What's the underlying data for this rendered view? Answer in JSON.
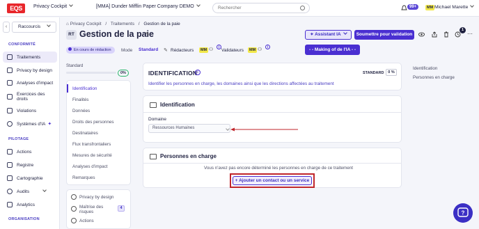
{
  "topbar": {
    "logo": "EQS",
    "app": "Privacy Cockpit",
    "company": "[MMA] Dunder Mifflin Paper Company DEMO",
    "search_placeholder": "Rechercher",
    "notif_count": "99+",
    "user_initials": "MM",
    "user_name": "Michael Marette"
  },
  "sidebar": {
    "shortcut_label": "Raccourcis",
    "section_conformite": "CONFORMITÉ",
    "items_conformite": [
      "Traitements",
      "Privacy by design",
      "Analyses d'impact",
      "Exercices des droits",
      "Violations",
      "Systèmes d'IA"
    ],
    "section_pilotage": "PILOTAGE",
    "items_pilotage": [
      "Actions",
      "Registre",
      "Cartographie",
      "Audits",
      "Analytics"
    ],
    "section_organisation": "ORGANISATION"
  },
  "breadcrumb": [
    "Privacy Cockpit",
    "Traitements",
    "Gestion de la paie"
  ],
  "header": {
    "tag": "RT",
    "title": "Gestion de la paie",
    "status": "En cours de rédaction",
    "mode_label": "Mode",
    "mode_value": "Standard",
    "redacteurs_label": "Rédacteurs",
    "validateurs_label": "Validateurs",
    "avatar": "MM",
    "assistant_button": "Assistant IA",
    "submit_button": "Soumettre pour validation",
    "making_of_button": "- - Making of de l'IA - -",
    "count_badge": "1"
  },
  "left_nav": {
    "level_label": "Standard",
    "level_pct": "0%",
    "items": [
      "Identification",
      "Finalités",
      "Données",
      "Droits des personnes",
      "Destinataires",
      "Flux transfrontaliers",
      "Mesures de sécurité",
      "Analyses d'impact",
      "Remarques"
    ],
    "bottom_items": [
      "Privacy by design",
      "Maîtrise des risques",
      "Actions"
    ],
    "risk_count": "4"
  },
  "identification_card": {
    "title": "IDENTIFICATION",
    "level": "STANDARD",
    "pct": "0 %",
    "description": "Identifier les personnes en charge, les domaines ainsi que les directions affectées au traitement"
  },
  "id_section": {
    "title": "Identification",
    "domain_label": "Domaine",
    "domain_value": "Ressources Humaines"
  },
  "persons_section": {
    "title": "Personnes en charge",
    "empty_text": "Vous n'avez pas encore déterminé les personnes en charge de ce traitement",
    "add_button": "Ajouter un contact ou un service"
  },
  "right_toc": [
    "Identification",
    "Personnes en charge"
  ],
  "colors": {
    "accent": "#4a2fd1",
    "logo": "#e8262b",
    "highlight": "#c0262b"
  }
}
